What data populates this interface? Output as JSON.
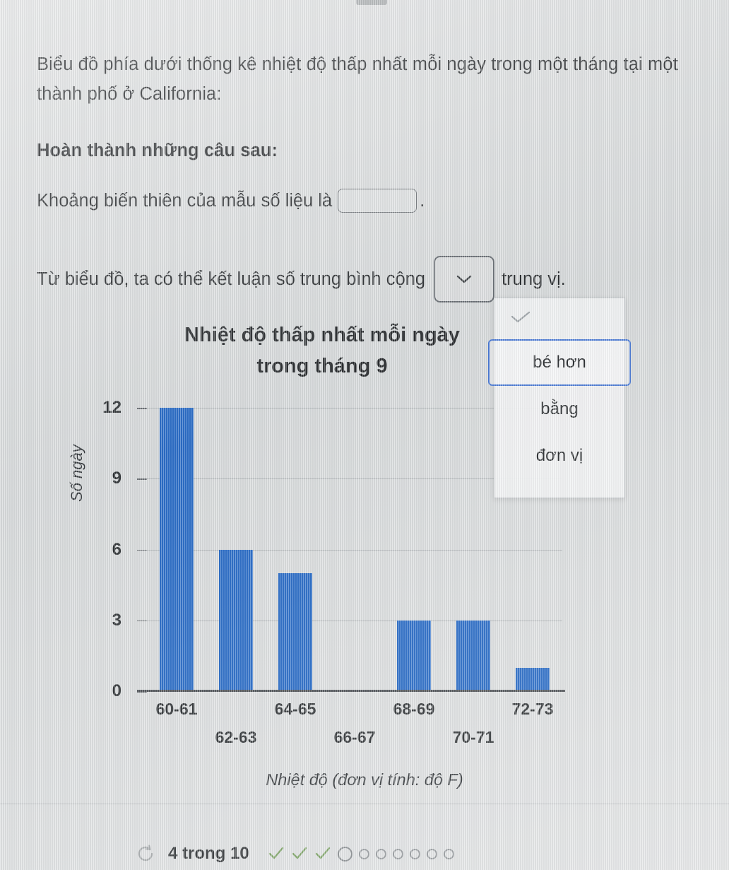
{
  "question": {
    "intro": "Biểu đồ phía dưới thống kê nhiệt độ thấp nhất mỗi ngày trong một tháng tại một thành phố ở California:",
    "complete_heading": "Hoàn thành những câu sau:",
    "range_prefix": "Khoảng biến thiên của mẫu số liệu là",
    "range_suffix": ".",
    "range_input_value": "",
    "conclusion_prefix": "Từ biểu đồ, ta có thể kết luận số trung bình cộng",
    "conclusion_suffix": "trung vị.",
    "select_value": "",
    "select_icon": "chevron-down-icon"
  },
  "dropdown": {
    "check_icon": "check-icon",
    "options": [
      {
        "label": "bé hơn",
        "selected": true
      },
      {
        "label": "bằng",
        "selected": false
      },
      {
        "label": "đơn vị",
        "selected": false
      }
    ]
  },
  "chart_data": {
    "type": "bar",
    "title": "Nhiệt độ thấp nhất mỗi ngày trong tháng 9",
    "title_line1": "Nhiệt độ thấp nhất mỗi ngày",
    "title_line2": "trong tháng 9",
    "xlabel": "Nhiệt độ (đơn vị tính: độ F)",
    "ylabel": "Số ngày",
    "categories": [
      "60-61",
      "62-63",
      "64-65",
      "66-67",
      "68-69",
      "70-71",
      "72-73"
    ],
    "values": [
      12,
      6,
      5,
      0,
      3,
      3,
      1
    ],
    "ylim": [
      0,
      12
    ],
    "yticks": [
      0,
      3,
      6,
      9,
      12
    ],
    "grid": true,
    "legend": false,
    "bar_color": "#1760c4",
    "axis_color": "#3e4247",
    "grid_color": "#9ea3a7"
  },
  "footer": {
    "refresh_icon": "refresh-icon",
    "progress_label": "4 trong 10",
    "completed_count": 3,
    "current_index": 4,
    "total": 10,
    "check_color": "#6f9a55"
  }
}
